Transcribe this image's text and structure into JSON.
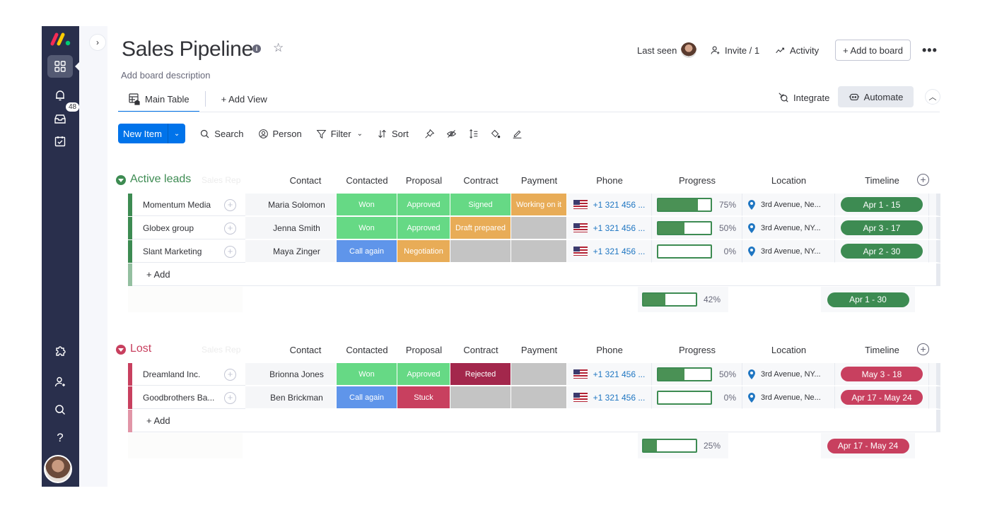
{
  "colors": {
    "nav_bg": "#292f4c",
    "primary": "#0073ea",
    "status_won": "#66d985",
    "status_working": "#e8ac57",
    "status_call_again": "#5f95ea",
    "status_stuck": "#c8405f",
    "status_rejected": "#a3274c",
    "status_empty": "#c4c4c4",
    "group_active": "#3d8b52",
    "group_lost": "#c8405f"
  },
  "nav": {
    "notifications_badge": "48",
    "icons": [
      "monday-logo",
      "workspace-grid-icon",
      "bell-icon",
      "inbox-icon",
      "my-work-icon",
      "apps-icon",
      "invite-user-icon",
      "search-icon",
      "help-icon",
      "user-avatar"
    ]
  },
  "header": {
    "title": "Sales Pipeline",
    "description": "Add board description",
    "last_seen": "Last seen",
    "invite": "Invite / 1",
    "activity": "Activity",
    "add_to_board": "+ Add to board",
    "more": "•••"
  },
  "tabs": {
    "main_table": "Main Table",
    "add_view": "+ Add View",
    "integrate": "Integrate",
    "automate": "Automate"
  },
  "toolbar": {
    "new_item": "New Item",
    "search": "Search",
    "person": "Person",
    "filter": "Filter",
    "sort": "Sort"
  },
  "columns": {
    "sales_rep": "Sales Rep",
    "contact": "Contact",
    "contacted": "Contacted",
    "proposal": "Proposal",
    "contract": "Contract",
    "payment": "Payment",
    "phone": "Phone",
    "progress": "Progress",
    "location": "Location",
    "timeline": "Timeline"
  },
  "groups": [
    {
      "title": "Active leads",
      "color": "#3d8b52",
      "add_label": "+ Add",
      "rows": [
        {
          "name": "Momentum Media",
          "contact": "Maria Solomon",
          "contacted": "Won",
          "proposal": "Approved",
          "contract": "Signed",
          "payment": "Working on it",
          "phone": "+1 321 456 ...",
          "progress": 75,
          "progress_label": "75%",
          "location": "3rd Avenue, Ne...",
          "timeline": "Apr 1 - 15"
        },
        {
          "name": "Globex group",
          "contact": "Jenna Smith",
          "contacted": "Won",
          "proposal": "Approved",
          "contract": "Draft prepared",
          "payment": "",
          "phone": "+1 321 456 ...",
          "progress": 50,
          "progress_label": "50%",
          "location": "3rd Avenue, NY...",
          "timeline": "Apr 3 - 17"
        },
        {
          "name": "Slant Marketing",
          "contact": "Maya Zinger",
          "contacted": "Call again",
          "proposal": "Negotiation",
          "contract": "",
          "payment": "",
          "phone": "+1 321 456 ...",
          "progress": 0,
          "progress_label": "0%",
          "location": "3rd Avenue, NY...",
          "timeline": "Apr 2 - 30"
        }
      ],
      "summary": {
        "progress": 42,
        "progress_label": "42%",
        "timeline": "Apr 1 - 30"
      }
    },
    {
      "title": "Lost",
      "color": "#c8405f",
      "add_label": "+ Add",
      "rows": [
        {
          "name": "Dreamland Inc.",
          "contact": "Brionna Jones",
          "contacted": "Won",
          "proposal": "Approved",
          "contract": "Rejected",
          "payment": "",
          "phone": "+1 321 456 ...",
          "progress": 50,
          "progress_label": "50%",
          "location": "3rd Avenue, NY...",
          "timeline": "May 3 - 18"
        },
        {
          "name": "Goodbrothers Ba...",
          "contact": "Ben Brickman",
          "contacted": "Call again",
          "proposal": "Stuck",
          "contract": "",
          "payment": "",
          "phone": "+1 321 456 ...",
          "progress": 0,
          "progress_label": "0%",
          "location": "3rd Avenue, Ne...",
          "timeline": "Apr 17 - May 24"
        }
      ],
      "summary": {
        "progress": 25,
        "progress_label": "25%",
        "timeline": "Apr 17 - May 24"
      }
    }
  ]
}
